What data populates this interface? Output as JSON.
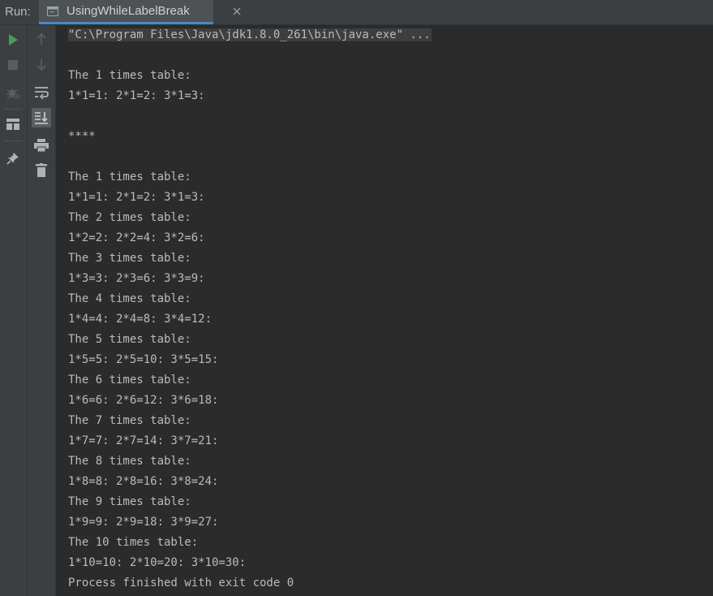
{
  "header": {
    "run_label": "Run:",
    "tab_label": "UsingWhileLabelBreak"
  },
  "toolbar": {
    "primary": [
      "run-icon",
      "stop-icon",
      "debug-icon",
      "layout-icon",
      "pin-icon"
    ],
    "secondary": [
      "arrow-up-icon",
      "arrow-down-icon",
      "soft-wrap-icon",
      "scroll-to-end-icon",
      "print-icon",
      "trash-icon"
    ]
  },
  "console": {
    "command": "\"C:\\Program Files\\Java\\jdk1.8.0_261\\bin\\java.exe\" ...",
    "lines": [
      "",
      "The 1 times table:",
      "1*1=1: 2*1=2: 3*1=3:",
      "",
      "****",
      "",
      "The 1 times table:",
      "1*1=1: 2*1=2: 3*1=3:",
      "The 2 times table:",
      "1*2=2: 2*2=4: 3*2=6:",
      "The 3 times table:",
      "1*3=3: 2*3=6: 3*3=9:",
      "The 4 times table:",
      "1*4=4: 2*4=8: 3*4=12:",
      "The 5 times table:",
      "1*5=5: 2*5=10: 3*5=15:",
      "The 6 times table:",
      "1*6=6: 2*6=12: 3*6=18:",
      "The 7 times table:",
      "1*7=7: 2*7=14: 3*7=21:",
      "The 8 times table:",
      "1*8=8: 2*8=16: 3*8=24:",
      "The 9 times table:",
      "1*9=9: 2*9=18: 3*9=27:",
      "The 10 times table:",
      "1*10=10: 2*10=20: 3*10=30:",
      "Process finished with exit code 0"
    ]
  },
  "colors": {
    "background": "#2b2b2b",
    "panel": "#3c3f41",
    "text": "#bbbbbb",
    "run_green": "#499c54",
    "tab_underline": "#4a88c7"
  }
}
